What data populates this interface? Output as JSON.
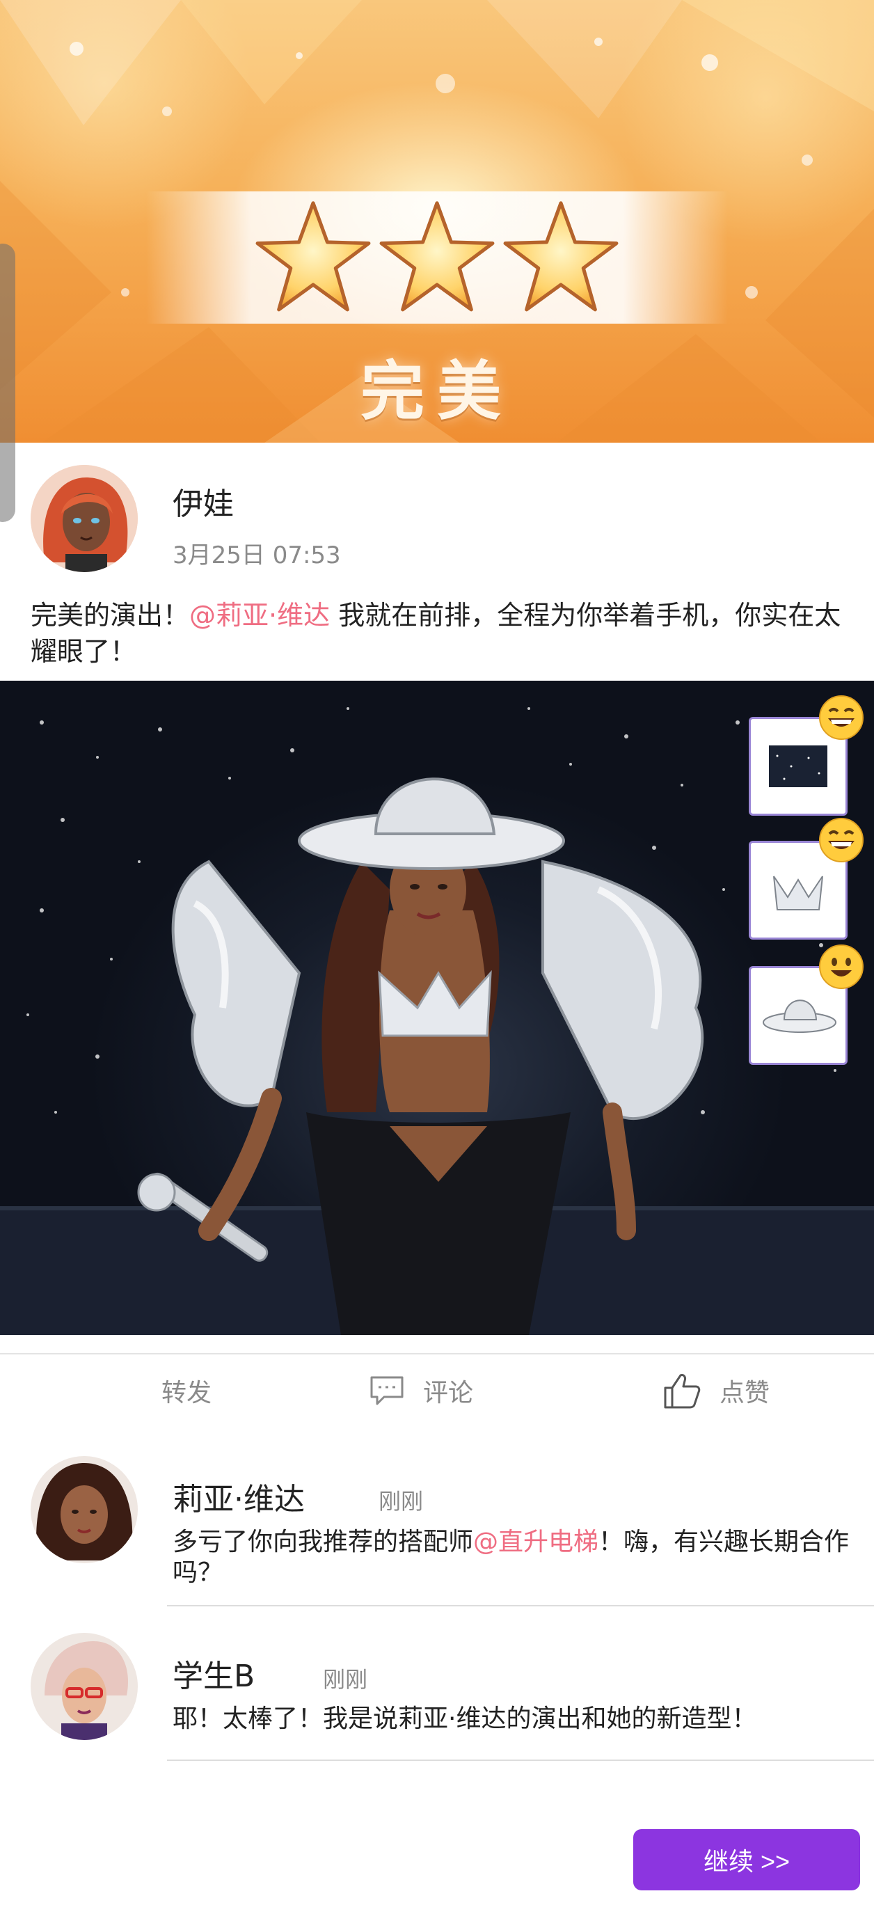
{
  "result": {
    "stars_earned": 3,
    "stars_total": 3,
    "rating_label": "完美"
  },
  "post": {
    "author": "伊娃",
    "timestamp": "3月25日 07:53",
    "text_before": "完美的演出！",
    "mention": "@莉亚·维达",
    "text_after": " 我就在前排，全程为你举着手机，你实在太耀眼了！"
  },
  "outfit_items": [
    {
      "name": "stage-background",
      "icon": "stage-thumbnail",
      "reaction": "grinning-face"
    },
    {
      "name": "silver-top",
      "icon": "silver-top-thumbnail",
      "reaction": "grinning-face"
    },
    {
      "name": "cowboy-hat",
      "icon": "hat-thumbnail",
      "reaction": "smiling-face"
    }
  ],
  "actions": {
    "share_label": "转发",
    "comment_label": "评论",
    "like_label": "点赞"
  },
  "comments": [
    {
      "author": "莉亚·维达",
      "time": "刚刚",
      "text_before": "多亏了你向我推荐的搭配师",
      "mention": "@直升电梯",
      "text_after": "！嗨，有兴趣长期合作吗？"
    },
    {
      "author": "学生B",
      "time": "刚刚",
      "text_before": "耶！太棒了！我是说莉亚·维达的演出和她的新造型！",
      "mention": "",
      "text_after": ""
    }
  ],
  "continue_label": "继续 >>",
  "colors": {
    "accent_purple": "#8c35e0",
    "mention_pink": "#ef6d82",
    "banner_orange": "#f6b058"
  }
}
